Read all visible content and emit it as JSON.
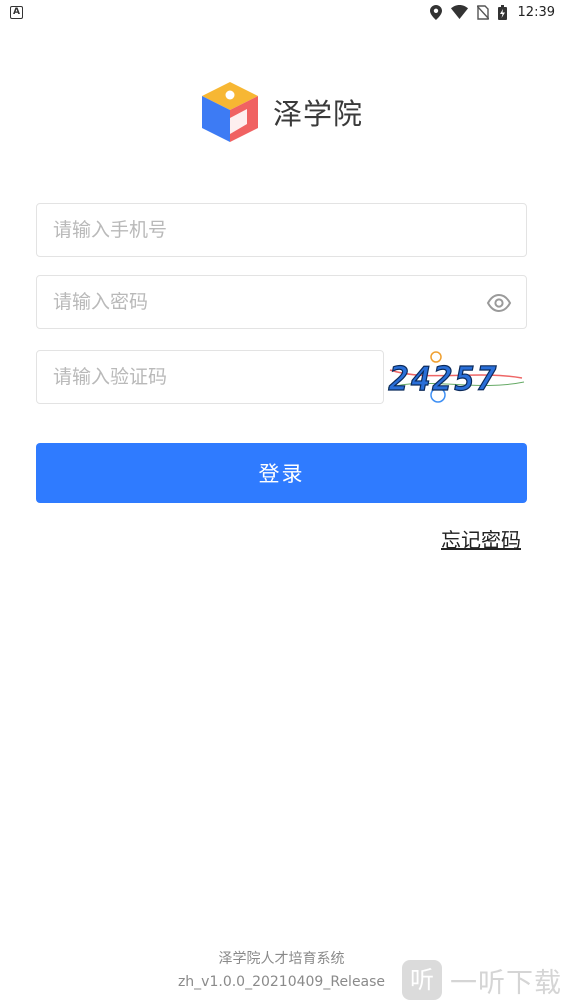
{
  "status_bar": {
    "left_badge": "A",
    "time": "12:39",
    "icons": [
      "location-icon",
      "wifi-icon",
      "no-sim-icon",
      "battery-charging-icon"
    ]
  },
  "logo": {
    "app_name": "泽学院",
    "colors": {
      "yellow": "#f7b733",
      "blue": "#3d7bf4",
      "red": "#f06262"
    }
  },
  "form": {
    "phone_placeholder": "请输入手机号",
    "password_placeholder": "请输入密码",
    "captcha_placeholder": "请输入验证码",
    "captcha_text": "24257"
  },
  "login_button": {
    "label": "登录",
    "color": "#2f7bff"
  },
  "forgot_password": "忘记密码",
  "footer": {
    "system_name": "泽学院人才培育系统",
    "version": "zh_v1.0.0_20210409_Release"
  },
  "watermark": {
    "logo_glyph": "听",
    "text": "一听下载"
  }
}
